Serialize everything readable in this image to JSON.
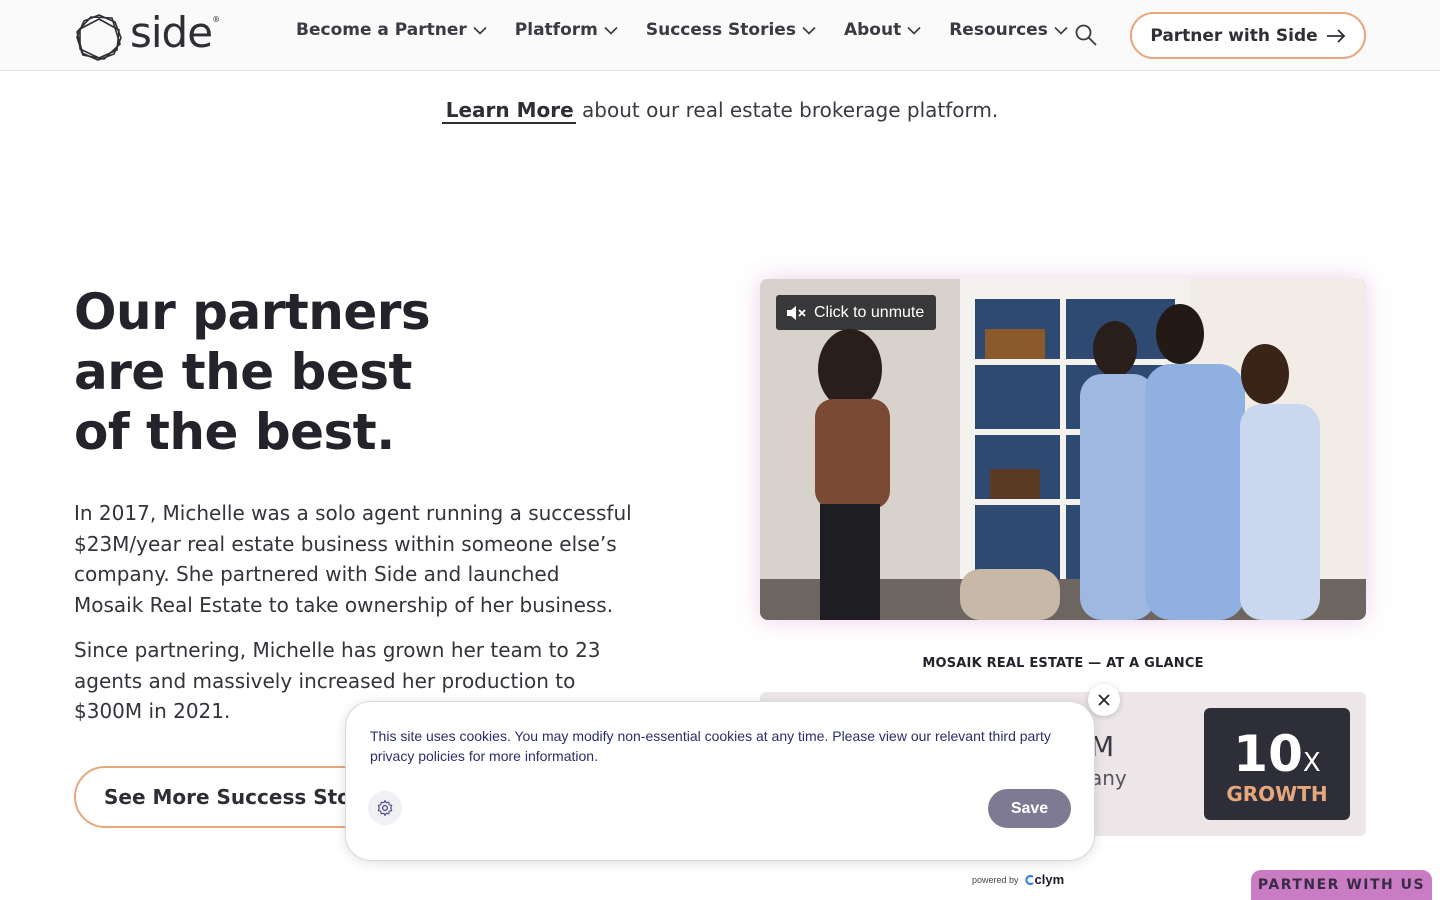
{
  "header": {
    "logo_text": "side",
    "nav": [
      {
        "label": "Become a Partner"
      },
      {
        "label": "Platform"
      },
      {
        "label": "Success Stories"
      },
      {
        "label": "About"
      },
      {
        "label": "Resources"
      }
    ],
    "cta_label": "Partner with Side"
  },
  "learn": {
    "link_text": "Learn More",
    "rest_text": " about our real estate brokerage platform."
  },
  "hero": {
    "line1": "Our partners",
    "line2_prefix": "are ",
    "line2_highlight": "the best",
    "line3": "of the best.",
    "para1": "In 2017, Michelle was a solo agent running a successful $23M/year real estate business within someone else’s company. She partnered with Side and launched Mosaik Real Estate to take ownership of her business.",
    "para2": "Since partnering, Michelle has grown her team to 23 agents and massively increased her production to $300M in 2021.",
    "stories_button": "See More Success Stories"
  },
  "video": {
    "unmute_label": "Click to unmute"
  },
  "glance": {
    "title": "MOSAIK REAL ESTATE —  AT A GLANCE",
    "stat_num_partial": "M",
    "stat_label_partial": "any",
    "growth_value": "10",
    "growth_suffix": "X",
    "growth_label": "GROWTH"
  },
  "cookie": {
    "text": "This site uses cookies. You may modify non-essential cookies at any time. Please view our relevant third party privacy policies for more information.",
    "save_label": "Save",
    "powered_by": "powered by",
    "brand": "clym"
  },
  "partner_tab": "PARTNER WITH US",
  "colors": {
    "accent_orange": "#e7a77c",
    "accent_pink": "#c97cc4",
    "dark": "#2e2e38"
  }
}
